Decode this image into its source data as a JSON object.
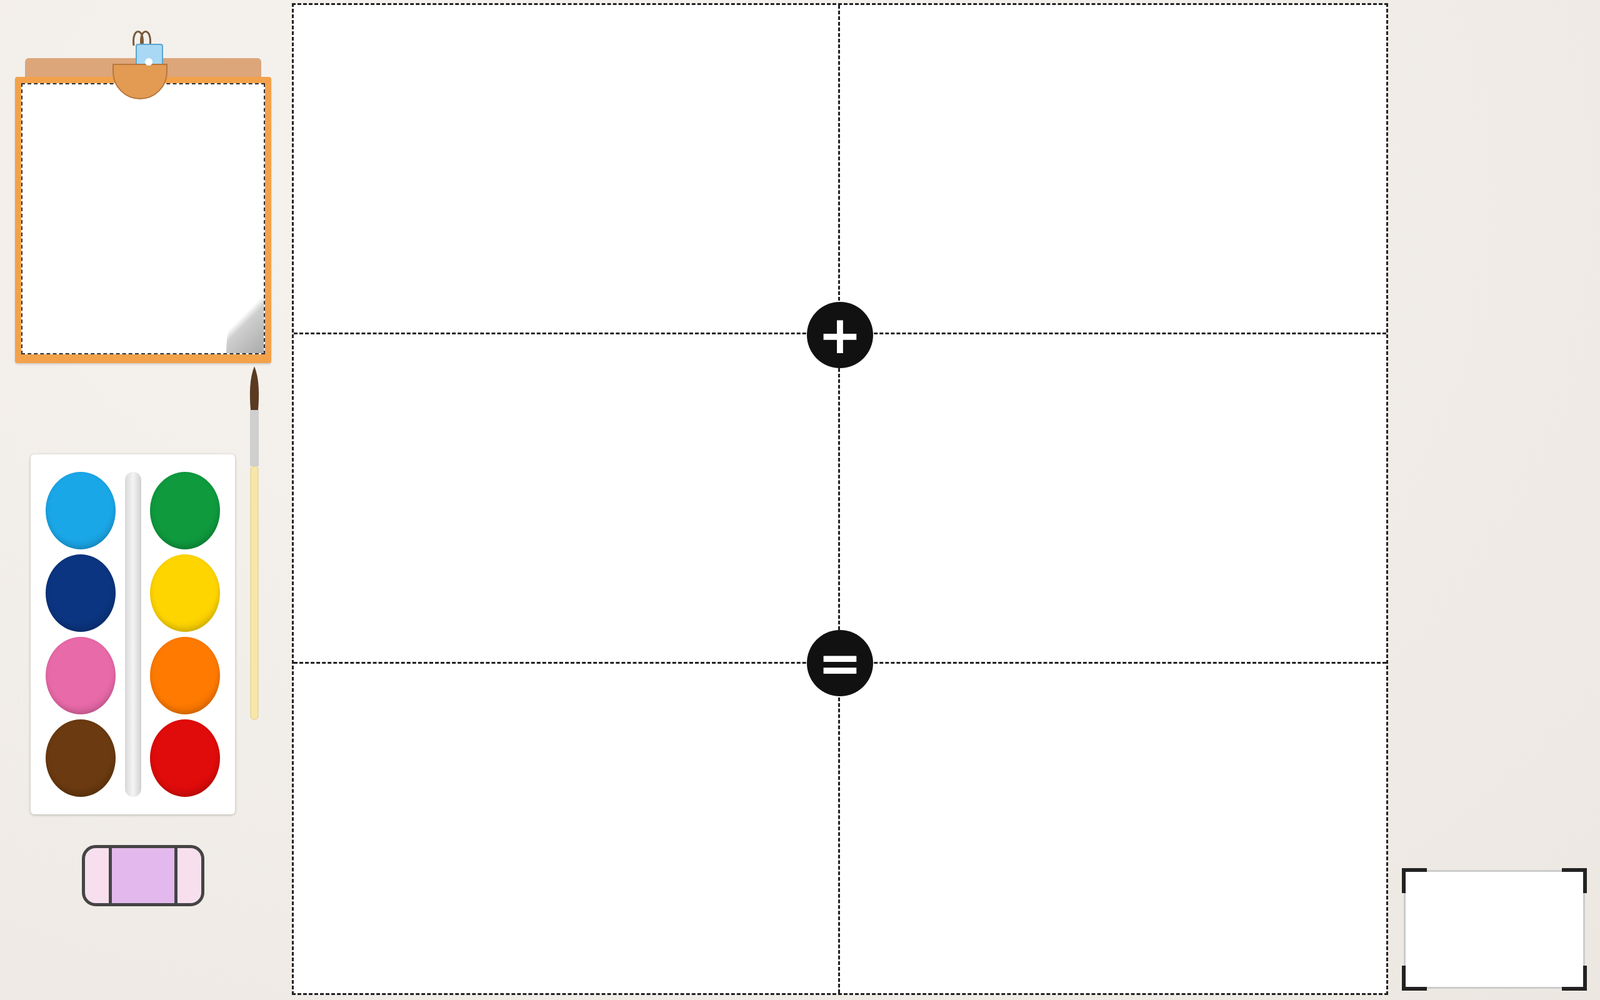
{
  "operators": [
    {
      "symbol": "+"
    },
    {
      "symbol": "="
    }
  ],
  "palette": {
    "paints": [
      {
        "color": "#1aa7e8"
      },
      {
        "color": "#0f9a3e"
      },
      {
        "color": "#0b3580"
      },
      {
        "color": "#ffd500"
      },
      {
        "color": "#e96aa9"
      },
      {
        "color": "#ff7a00"
      },
      {
        "color": "#6b3a10"
      },
      {
        "color": "#e00b0b"
      }
    ]
  }
}
